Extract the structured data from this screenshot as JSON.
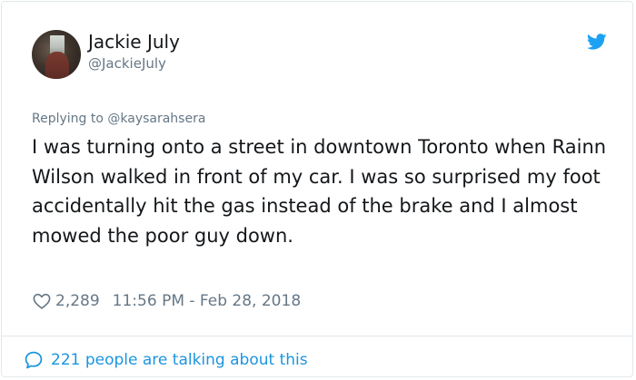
{
  "tweet": {
    "display_name": "Jackie July",
    "handle": "@JackieJuly",
    "replying_to": "Replying to @kaysarahsera",
    "text": "I was turning onto a street in downtown Toronto when Rainn Wilson walked in front of my car. I was so surprised my foot accidentally hit the gas instead of the brake and I almost mowed the poor guy down.",
    "likes": "2,289",
    "timestamp": "11:56 PM - Feb 28, 2018",
    "talking": "221 people are talking about this"
  },
  "icons": {
    "brand": "twitter-bird-icon",
    "like": "heart-icon",
    "conversation": "speech-bubble-icon"
  },
  "colors": {
    "twitter_blue": "#1da1f2",
    "link_blue": "#1b95e0",
    "muted_text": "#657786",
    "primary_text": "#14171a",
    "border": "#e1e8ed"
  }
}
